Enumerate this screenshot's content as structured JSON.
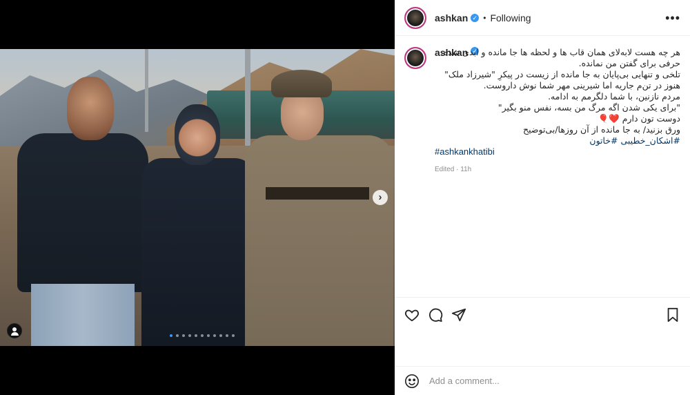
{
  "post": {
    "username": "ashkan",
    "verified_glyph": "✓",
    "separator": "•",
    "follow_status": "Following",
    "more_glyph": "•••",
    "next_glyph": "›"
  },
  "caption": {
    "username": "ashkan",
    "lines": [
      "هر چه هست لابه‌لای همان قاب ها و لحظه ها جا مانده و ابدی شده.",
      "حرفی برای گفتن من نمانده.",
      "تلخی و تنهایی بی‌پایان به جا مانده از زیست در پیکرِ \"شیرزاد ملک\"",
      "هنوز در تن‌م جاریه اما شیرینی مهر شما نوش داروست.",
      "مردم نازنین، با شما دلگرمم به ادامه.",
      "\"برای یکی شدن اگه مرگ من بسه، نفس منو بگیر\"",
      "دوست تون دارم ❤️🎈",
      "ورق بزنید/ به جا مانده از آن روزها/بی‌توضیح"
    ],
    "hashtags": [
      "#اشکان_خطیبی #خاتون",
      "#ashkankhatibi"
    ],
    "meta": "Edited · 11h"
  },
  "comment": {
    "placeholder": "Add a comment..."
  },
  "carousel": {
    "count": 11,
    "active_index": 0
  },
  "icons": {
    "like": "heart-icon",
    "comment": "comment-icon",
    "share": "send-icon",
    "save": "bookmark-icon",
    "emoji": "emoji-icon",
    "tag": "user-tag-icon"
  },
  "colors": {
    "link": "#00376b",
    "verified": "#3897f0",
    "ring": "#c13584"
  }
}
